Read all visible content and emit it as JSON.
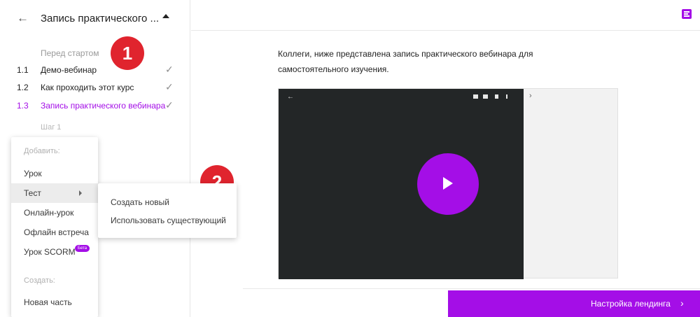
{
  "sidebar": {
    "back_icon": "arrow-left-icon",
    "course_title": "Запись практического ...",
    "section_label": "Перед стартом",
    "lessons": [
      {
        "num": "1.1",
        "label": "Демо-вебинар",
        "done": true
      },
      {
        "num": "1.2",
        "label": "Как проходить этот курс",
        "done": true
      },
      {
        "num": "1.3",
        "label": "Запись практического вебинара",
        "done": true,
        "active": true
      }
    ],
    "step_label": "Шаг 1"
  },
  "badges": [
    "1",
    "2"
  ],
  "add_menu": {
    "add_label": "Добавить:",
    "items": [
      "Урок",
      "Тест",
      "Онлайн-урок",
      "Офлайн встреча",
      "Урок SCORM"
    ],
    "beta": "Бета",
    "create_label": "Создать:",
    "create_items": [
      "Новая часть"
    ]
  },
  "sub_menu": {
    "items": [
      "Создать новый",
      "Использовать существующий"
    ]
  },
  "main": {
    "intro_text": "Коллеги, ниже представлена запись практического вебинара  для самостоятельного изучения.",
    "landing_button": "Настройка лендинга",
    "chevron": "›"
  },
  "colors": {
    "accent": "#a40ee7",
    "badge": "#e0242e"
  }
}
